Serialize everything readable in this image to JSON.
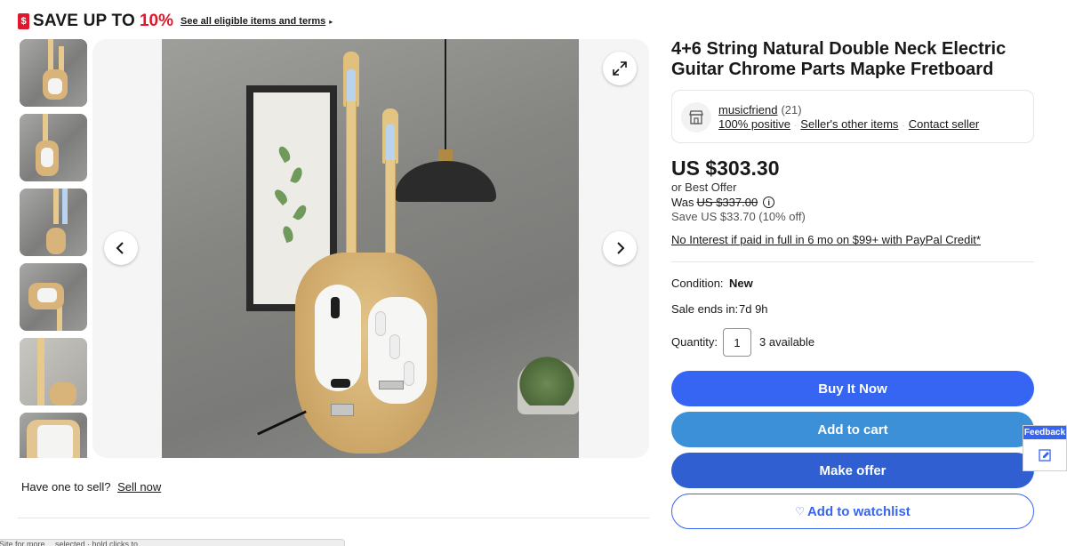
{
  "promo": {
    "icon_label": "$",
    "text": "SAVE UP TO",
    "percent": "10%",
    "link": "See all eligible items and terms",
    "caret": "▸"
  },
  "gallery": {
    "thumbnails": [
      "thumb-1",
      "thumb-2",
      "thumb-3",
      "thumb-4",
      "thumb-5",
      "thumb-6"
    ],
    "active_index": 0,
    "prev_icon": "chevron-left-icon",
    "next_icon": "chevron-right-icon",
    "expand_icon": "expand-icon"
  },
  "sell": {
    "question": "Have one to sell?",
    "link": "Sell now"
  },
  "bottom_bar": {
    "text": "Site for more… selected · hold clicks to…"
  },
  "listing": {
    "title": "4+6 String Natural Double Neck Electric Guitar Chrome Parts Mapke Fretboard"
  },
  "seller": {
    "name": "musicfriend",
    "feedback_count": "(21)",
    "positive": "100% positive",
    "other_items": "Seller's other items",
    "contact": "Contact seller",
    "icon": "store-icon"
  },
  "pricing": {
    "price": "US $303.30",
    "best_offer": "or Best Offer",
    "was_label": "Was",
    "was_price": "US $337.00",
    "save": "Save US $33.70 (10% off)",
    "paypal": "No Interest if paid in full in 6 mo on $99+ with PayPal Credit*"
  },
  "details": {
    "condition_label": "Condition:",
    "condition_value": "New",
    "sale_label": "Sale ends in:",
    "sale_value": "7d 9h",
    "quantity_label": "Quantity:",
    "quantity_value": "1",
    "available": "3 available"
  },
  "buttons": {
    "buy": "Buy It Now",
    "cart": "Add to cart",
    "offer": "Make offer",
    "watch": "Add to watchlist",
    "watch_icon": "♡"
  },
  "feedback_tab": {
    "label": "Feedback",
    "icon": "edit-icon"
  },
  "colors": {
    "primary": "#3665f3",
    "promo_red": "#e0182d",
    "text": "#191919"
  }
}
